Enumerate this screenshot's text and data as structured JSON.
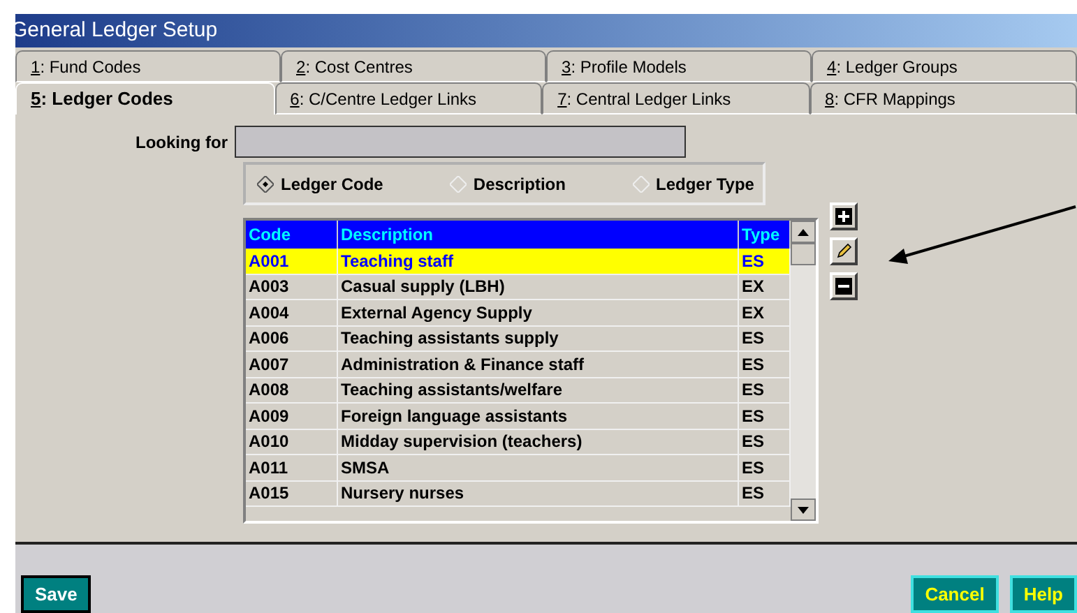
{
  "window": {
    "title": "General Ledger Setup"
  },
  "tab_rows": [
    [
      {
        "key": "1",
        "rest": ": Fund Codes",
        "selected": false
      },
      {
        "key": "2",
        "rest": ": Cost Centres",
        "selected": false
      },
      {
        "key": "3",
        "rest": ": Profile Models",
        "selected": false
      },
      {
        "key": "4",
        "rest": ": Ledger Groups",
        "selected": false
      }
    ],
    [
      {
        "key": "5",
        "rest": ": Ledger Codes",
        "selected": true
      },
      {
        "key": "6",
        "rest": ": C/Centre Ledger Links",
        "selected": false
      },
      {
        "key": "7",
        "rest": ": Central Ledger Links",
        "selected": false
      },
      {
        "key": "8",
        "rest": ": CFR Mappings",
        "selected": false
      }
    ]
  ],
  "search": {
    "label": "Looking for"
  },
  "search_by": [
    {
      "label": "Ledger Code",
      "selected": true
    },
    {
      "label": "Description",
      "selected": false
    },
    {
      "label": "Ledger Type",
      "selected": false
    }
  ],
  "table": {
    "columns": [
      "Code",
      "Description",
      "Type"
    ],
    "rows": [
      {
        "cells": [
          "A001",
          "Teaching staff",
          "ES"
        ],
        "selected": true
      },
      {
        "cells": [
          "A003",
          "Casual supply (LBH)",
          "EX"
        ],
        "selected": false
      },
      {
        "cells": [
          "A004",
          "External Agency Supply",
          "EX"
        ],
        "selected": false
      },
      {
        "cells": [
          "A006",
          "Teaching assistants supply",
          "ES"
        ],
        "selected": false
      },
      {
        "cells": [
          "A007",
          "Administration & Finance staff",
          "ES"
        ],
        "selected": false
      },
      {
        "cells": [
          "A008",
          "Teaching assistants/welfare",
          "ES"
        ],
        "selected": false
      },
      {
        "cells": [
          "A009",
          "Foreign language assistants",
          "ES"
        ],
        "selected": false
      },
      {
        "cells": [
          "A010",
          "Midday supervision (teachers)",
          "ES"
        ],
        "selected": false
      },
      {
        "cells": [
          "A011",
          "SMSA",
          "ES"
        ],
        "selected": false
      },
      {
        "cells": [
          "A015",
          "Nursery nurses",
          "ES"
        ],
        "selected": false
      }
    ]
  },
  "side_tools": [
    {
      "kind": "add"
    },
    {
      "kind": "edit"
    },
    {
      "kind": "remove"
    }
  ],
  "buttons": [
    {
      "label": "Save",
      "kind": "primary"
    },
    {
      "label": "Cancel",
      "kind": "secondary"
    },
    {
      "label": "Help",
      "kind": "secondary"
    }
  ]
}
